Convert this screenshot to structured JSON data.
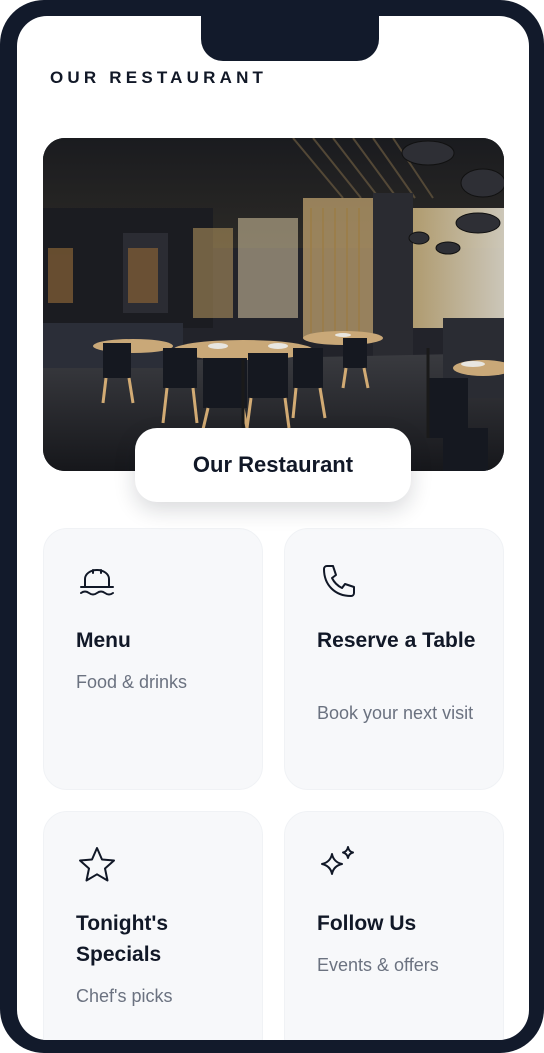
{
  "header": {
    "title": "OUR RESTAURANT"
  },
  "hero": {
    "image_subject": "restaurant-interior-photo",
    "label": "Our Restaurant"
  },
  "cards": [
    {
      "title": "Menu",
      "subtitle": "Food & drinks",
      "icon": "cloche-icon"
    },
    {
      "title": "Reserve a Table",
      "subtitle": "Book your next visit",
      "icon": "phone-icon"
    },
    {
      "title": "Tonight's Specials",
      "subtitle": "Chef's picks",
      "icon": "star-icon"
    },
    {
      "title": "Follow Us",
      "subtitle": "Events & offers",
      "icon": "sparkles-icon"
    }
  ],
  "colors": {
    "frame": "#121a2b",
    "text_primary": "#111827",
    "text_secondary": "#6b7280",
    "card_bg": "#f7f8fa"
  }
}
